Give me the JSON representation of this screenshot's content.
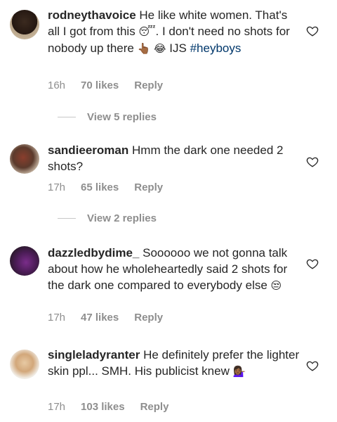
{
  "comments": [
    {
      "username": "rodneythavoice",
      "text_parts": [
        "He like white women. That's all I got from this ",
        "😴",
        ". I don't need no shots for nobody up there ",
        "👆🏾",
        " ",
        "😂",
        " IJS "
      ],
      "hashtag": "#heyboys",
      "time": "16h",
      "likes": "70 likes",
      "reply": "Reply",
      "view_replies": "View 5 replies",
      "avatar_icon": "avatar-icon"
    },
    {
      "username": "sandieeroman",
      "text": "Hmm the dark one needed 2 shots?",
      "time": "17h",
      "likes": "65 likes",
      "reply": "Reply",
      "view_replies": "View 2 replies",
      "avatar_icon": "avatar-icon"
    },
    {
      "username": "dazzledbydime_",
      "text": "Soooooo we not gonna talk about how he wholeheartedly said 2 shots for the dark one compared to everybody else ",
      "emoji": "😒",
      "time": "17h",
      "likes": "47 likes",
      "reply": "Reply",
      "avatar_icon": "avatar-icon"
    },
    {
      "username": "singleladyranter",
      "text": "He definitely prefer the lighter skin ppl... SMH. His publicist knew ",
      "emoji": "💁🏾‍♀️",
      "time": "17h",
      "likes": "103 likes",
      "reply": "Reply",
      "avatar_icon": "avatar-icon"
    }
  ],
  "colors": {
    "text": "#262626",
    "muted": "#8e8e8e",
    "hashtag": "#00376b",
    "divider": "#c7c7c7"
  }
}
